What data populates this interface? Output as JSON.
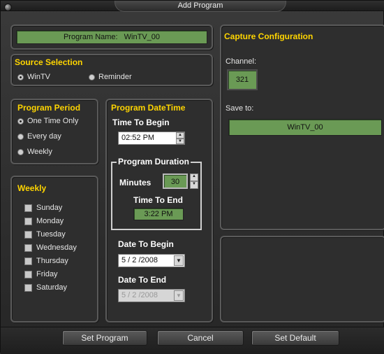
{
  "window": {
    "title": "Add Program"
  },
  "program_name": {
    "label": "Program Name:",
    "value": "WinTV_00"
  },
  "source_selection": {
    "title": "Source Selection",
    "options": [
      {
        "label": "WinTV",
        "selected": true
      },
      {
        "label": "Reminder",
        "selected": false
      }
    ]
  },
  "program_period": {
    "title": "Program Period",
    "options": [
      {
        "label": "One Time Only",
        "selected": true
      },
      {
        "label": "Every day",
        "selected": false
      },
      {
        "label": "Weekly",
        "selected": false
      }
    ]
  },
  "weekly": {
    "title": "Weekly",
    "days": [
      "Sunday",
      "Monday",
      "Tuesday",
      "Wednesday",
      "Thursday",
      "Friday",
      "Saturday"
    ]
  },
  "program_datetime": {
    "title": "Program DateTime",
    "time_to_begin_label": "Time To Begin",
    "time_to_begin_value": "02:52 PM",
    "duration_title": "Program Duration",
    "minutes_label": "Minutes",
    "minutes_value": "30",
    "time_to_end_label": "Time To End",
    "time_to_end_value": "3:22 PM",
    "date_to_begin_label": "Date To Begin",
    "date_to_begin_value": "5 / 2 /2008",
    "date_to_end_label": "Date To End",
    "date_to_end_value": "5 / 2 /2008"
  },
  "capture_configuration": {
    "title": "Capture Configuration",
    "channel_label": "Channel:",
    "channel_value": "321",
    "save_to_label": "Save to:",
    "save_to_value": "WinTV_00"
  },
  "buttons": {
    "set_program": "Set Program",
    "cancel": "Cancel",
    "set_default": "Set Default"
  },
  "colors": {
    "accent_title": "#ffd500",
    "field_green": "#6a9a55",
    "panel_bg": "#2e2e2e"
  }
}
